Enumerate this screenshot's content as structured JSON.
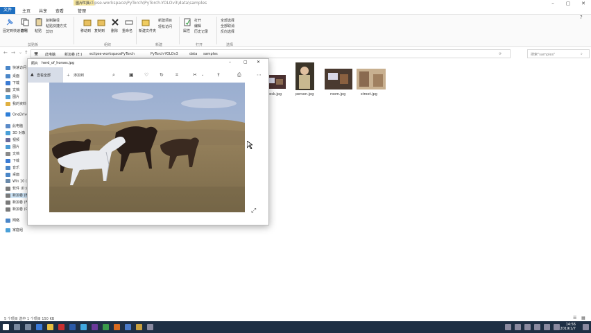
{
  "window": {
    "title": "E:\\eclipse-workspace\\PyTorch\\PyTorch-YOLOv3\\data\\samples",
    "tools_tab": "图片工具"
  },
  "ribbon_tabs": [
    "文件",
    "主页",
    "共享",
    "查看",
    "管理"
  ],
  "ribbon": {
    "items": [
      "固定到快速访问",
      "复制",
      "粘贴",
      "复制路径",
      "粘贴快捷方式",
      "剪切",
      "移动到",
      "复制到",
      "删除",
      "重命名",
      "新建文件夹",
      "新建项目",
      "轻松访问",
      "属性",
      "打开",
      "编辑",
      "历史记录",
      "全部选择",
      "全部取消",
      "反向选择"
    ],
    "groups": [
      "剪贴板",
      "组织",
      "新建",
      "打开",
      "选择"
    ]
  },
  "address": {
    "crumbs": [
      "此电脑",
      "新加卷 (E:)",
      "eclipse-workspace",
      "PyTorch",
      "PyTorch-YOLOv3",
      "data",
      "samples"
    ],
    "search_placeholder": "搜索\"samples\""
  },
  "nav": [
    {
      "label": "快速访问",
      "color": "#4a86c8"
    },
    {
      "label": "桌面",
      "color": "#4a86c8"
    },
    {
      "label": "下载",
      "color": "#3b7bd4"
    },
    {
      "label": "文档",
      "color": "#8a8a8a"
    },
    {
      "label": "图片",
      "color": "#4a9ad4"
    },
    {
      "label": "我的资料",
      "color": "#e0b040"
    },
    {
      "label": "OneDrive",
      "color": "#2f7fd8"
    },
    {
      "label": "此电脑",
      "color": "#5a8ac8"
    },
    {
      "label": "3D 对象",
      "color": "#4aa0d8"
    },
    {
      "label": "视频",
      "color": "#6a6a9a"
    },
    {
      "label": "图片",
      "color": "#4a9ad4"
    },
    {
      "label": "文档",
      "color": "#8a8a8a"
    },
    {
      "label": "下载",
      "color": "#3b7bd4"
    },
    {
      "label": "音乐",
      "color": "#4a86c8"
    },
    {
      "label": "桌面",
      "color": "#4a86c8"
    },
    {
      "label": "Win 10 (C:)",
      "color": "#6a8aaa"
    },
    {
      "label": "软件 (D:)",
      "color": "#7a7a7a"
    },
    {
      "label": "新加卷 (E:)",
      "color": "#7a7a7a"
    },
    {
      "label": "新加卷 (F:)",
      "color": "#7a7a7a"
    },
    {
      "label": "新加卷 (G:)",
      "color": "#7a7a7a"
    },
    {
      "label": "网络",
      "color": "#4a86c8"
    },
    {
      "label": "家庭组",
      "color": "#4aa0d8"
    }
  ],
  "files": [
    {
      "name": "desk.jpg"
    },
    {
      "name": "person.jpg"
    },
    {
      "name": "room.jpg"
    },
    {
      "name": "street.jpg"
    }
  ],
  "photos": {
    "app": "照片",
    "file": "herd_of_horses.jpg",
    "toolbar_view_all": "查看全部",
    "toolbar_add": "添加到"
  },
  "status": "5 个项目   选中 1 个项目  150 KB",
  "clock": {
    "time": "14:56",
    "date": "2019/1/7"
  }
}
